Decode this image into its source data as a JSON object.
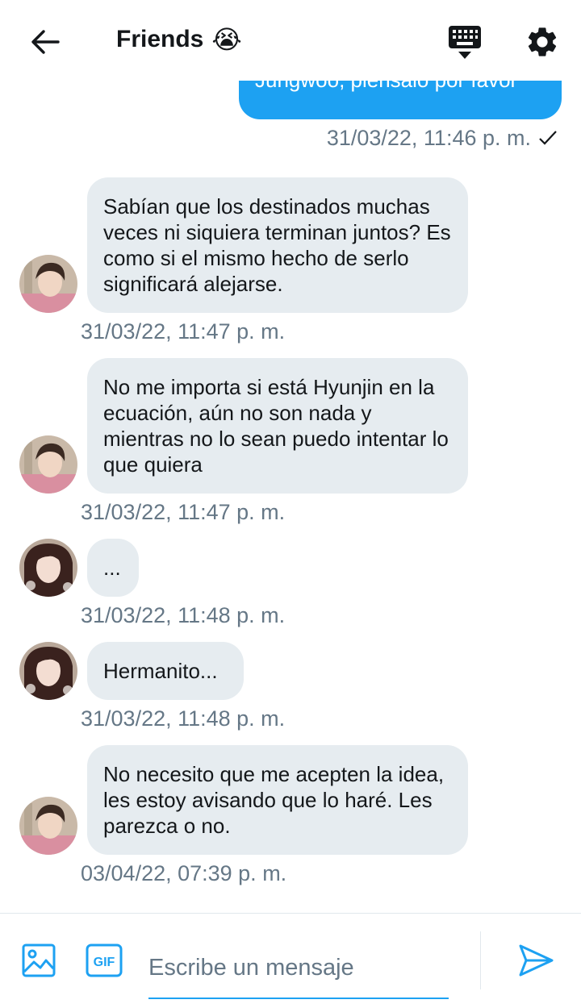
{
  "header": {
    "title": "Friends",
    "title_emoji": "😭",
    "back_icon": "arrow-left-icon",
    "keyboard_icon": "keyboard-icon",
    "settings_icon": "gear-icon"
  },
  "colors": {
    "accent": "#1da1f2",
    "incoming_bubble": "#e6ecf0",
    "timestamp": "#657786",
    "text": "#14171a"
  },
  "messages": [
    {
      "direction": "outgoing",
      "text": "Jungwoo, piénsalo por favor",
      "time": "31/03/22, 11:46 p. m.",
      "status": "✓"
    },
    {
      "direction": "incoming",
      "sender_avatar": "avatar-male",
      "text": "Sabían que los destinados muchas veces ni siquiera terminan juntos? Es como si el mismo hecho de serlo significará alejarse.",
      "time": "31/03/22, 11:47 p. m."
    },
    {
      "direction": "incoming",
      "sender_avatar": "avatar-male",
      "text": "No me importa si está Hyunjin en la ecuación, aún no son nada y mientras no lo sean puedo intentar lo que quiera",
      "time": "31/03/22, 11:47 p. m."
    },
    {
      "direction": "incoming",
      "sender_avatar": "avatar-female",
      "text": "...",
      "time": "31/03/22, 11:48 p. m."
    },
    {
      "direction": "incoming",
      "sender_avatar": "avatar-female",
      "text": "Hermanito...",
      "time": "31/03/22, 11:48 p. m."
    },
    {
      "direction": "incoming",
      "sender_avatar": "avatar-male",
      "text": "No necesito que me acepten la idea, les estoy avisando que lo haré. Les parezca o no.",
      "time": "03/04/22, 07:39 p. m."
    }
  ],
  "composer": {
    "placeholder": "Escribe un mensaje",
    "image_icon": "image-icon",
    "gif_label": "GIF",
    "send_icon": "send-icon"
  }
}
